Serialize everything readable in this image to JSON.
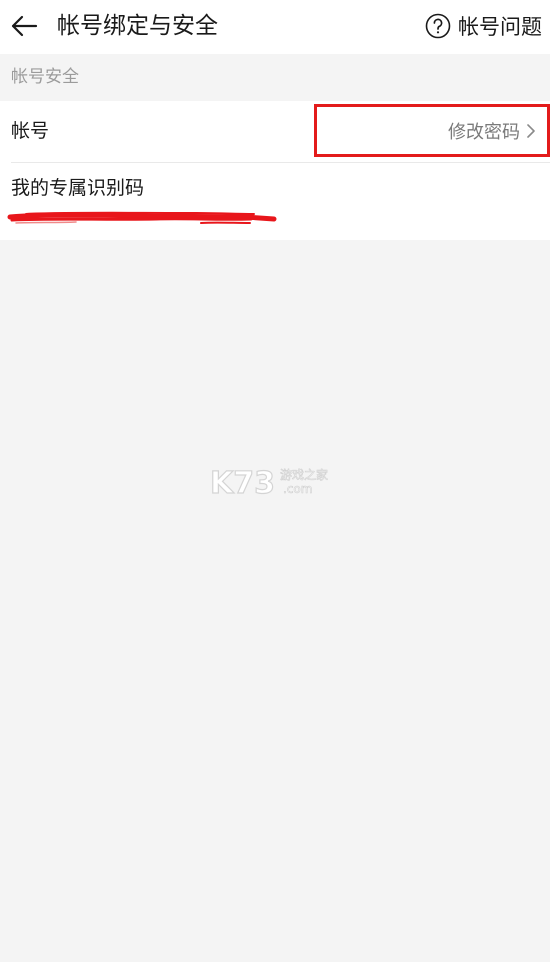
{
  "header": {
    "title": "帐号绑定与安全",
    "back_icon": "arrow-left-icon",
    "help_label": "帐号问题",
    "help_icon": "question-circle-icon"
  },
  "section": {
    "label": "帐号安全"
  },
  "account_row": {
    "label": "帐号",
    "action_label": "修改密码",
    "action_icon": "chevron-right-icon",
    "highlight_color": "#e31b1b"
  },
  "id_row": {
    "label": "我的专属识别码",
    "redaction_color": "#e8161b"
  },
  "watermark": {
    "brand": "K73",
    "caption": "游戏之家",
    "domain": ".com"
  },
  "colors": {
    "background": "#f4f4f4",
    "card": "#ffffff",
    "text_primary": "#1b1b1b",
    "text_secondary": "#9b9b9b"
  }
}
